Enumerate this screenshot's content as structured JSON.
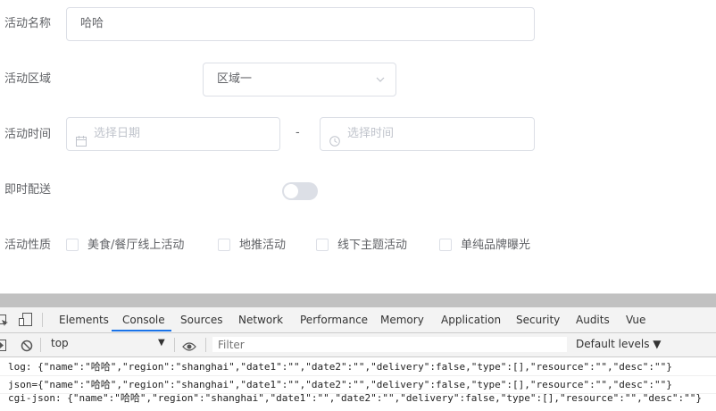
{
  "form": {
    "name_label": "活动名称",
    "name_value": "哈哈",
    "region_label": "活动区域",
    "region_value": "区域一",
    "time_label": "活动时间",
    "date_placeholder": "选择日期",
    "dash": "-",
    "time_placeholder": "选择时间",
    "delivery_label": "即时配送",
    "delivery_on": false,
    "type_label": "活动性质",
    "types": [
      "美食/餐厅线上活动",
      "地推活动",
      "线下主题活动",
      "单纯品牌曝光"
    ]
  },
  "devtools": {
    "tabs": [
      "Elements",
      "Console",
      "Sources",
      "Network",
      "Performance",
      "Memory",
      "Application",
      "Security",
      "Audits",
      "Vue"
    ],
    "active_tab": "Console",
    "context": "top",
    "filter_placeholder": "Filter",
    "levels": "Default levels ▼",
    "logs": [
      "log: {\"name\":\"哈哈\",\"region\":\"shanghai\",\"date1\":\"\",\"date2\":\"\",\"delivery\":false,\"type\":[],\"resource\":\"\",\"desc\":\"\"}",
      "json={\"name\":\"哈哈\",\"region\":\"shanghai\",\"date1\":\"\",\"date2\":\"\",\"delivery\":false,\"type\":[],\"resource\":\"\",\"desc\":\"\"}",
      "cgi-json: {\"name\":\"哈哈\",\"region\":\"shanghai\",\"date1\":\"\",\"date2\":\"\",\"delivery\":false,\"type\":[],\"resource\":\"\",\"desc\":\"\"}"
    ]
  },
  "colors": {
    "accent": "#1a73e8",
    "border": "#dcdfe6",
    "placeholder": "#c0c4cc"
  }
}
